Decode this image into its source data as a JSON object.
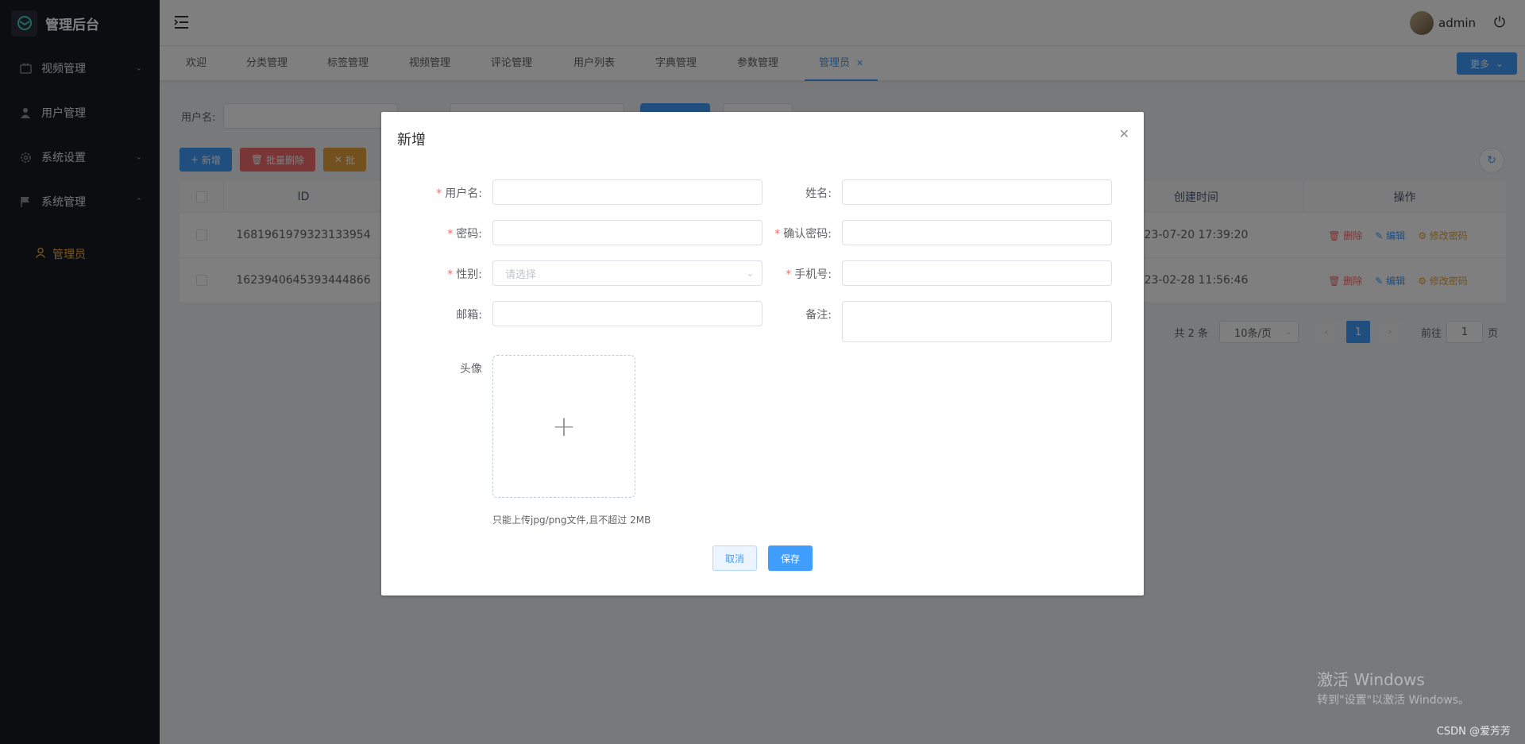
{
  "sidebar": {
    "logo_text": "管理后台",
    "items": [
      {
        "label": "视频管理"
      },
      {
        "label": "用户管理"
      },
      {
        "label": "系统设置"
      },
      {
        "label": "系统管理"
      }
    ],
    "sub_item": "管理员",
    "active_color": "#f5b540"
  },
  "header": {
    "username": "admin"
  },
  "tabs": [
    "欢迎",
    "分类管理",
    "标签管理",
    "视频管理",
    "评论管理",
    "用户列表",
    "字典管理",
    "参数管理",
    "管理员"
  ],
  "tabs_more": "更多",
  "search": {
    "username_label": "用户名:"
  },
  "actions": {
    "add": "新增",
    "batch_delete": "批量删除",
    "batch_other": "批"
  },
  "table": {
    "columns": [
      "ID",
      "创建时间",
      "操作"
    ],
    "rows": [
      {
        "id": "1681961979323133954",
        "created": "23-07-20 17:39:20"
      },
      {
        "id": "1623940645393444866",
        "created": "23-02-28 11:56:46"
      }
    ],
    "ops": {
      "delete": "删除",
      "edit": "编辑",
      "change_pwd": "修改密码"
    }
  },
  "pager": {
    "total": "共 2 条",
    "page_size": "10条/页",
    "current": "1",
    "goto_label": "前往",
    "goto_value": "1",
    "page_unit": "页"
  },
  "dialog": {
    "title": "新增",
    "fields": {
      "username": "用户名:",
      "name": "姓名:",
      "password": "密码:",
      "confirm_password": "确认密码:",
      "gender": "性别:",
      "gender_placeholder": "请选择",
      "phone": "手机号:",
      "email": "邮箱:",
      "remark": "备注:",
      "avatar": "头像"
    },
    "upload_tip": "只能上传jpg/png文件,且不超过 2MB",
    "cancel": "取消",
    "save": "保存"
  },
  "watermark": {
    "line1": "激活 Windows",
    "line2": "转到\"设置\"以激活 Windows。",
    "csdn": "CSDN @爱芳芳"
  },
  "colors": {
    "primary": "#409eff",
    "danger": "#f56c6c",
    "warning": "#e6a23c"
  }
}
